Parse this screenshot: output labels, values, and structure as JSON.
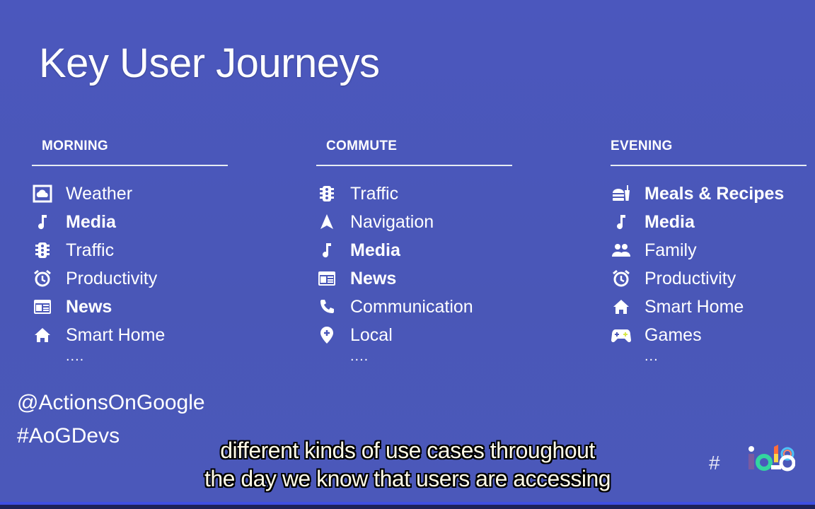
{
  "slide": {
    "title": "Key User Journeys",
    "columns": [
      {
        "header": "MORNING",
        "items": [
          {
            "icon": "weather-cloud-icon",
            "label": "Weather",
            "bold": false
          },
          {
            "icon": "music-note-icon",
            "label": "Media",
            "bold": true
          },
          {
            "icon": "traffic-light-icon",
            "label": "Traffic",
            "bold": false
          },
          {
            "icon": "alarm-clock-icon",
            "label": "Productivity",
            "bold": false
          },
          {
            "icon": "newspaper-icon",
            "label": "News",
            "bold": true
          },
          {
            "icon": "home-icon",
            "label": "Smart Home",
            "bold": false
          }
        ],
        "ellipsis": "...."
      },
      {
        "header": "COMMUTE",
        "items": [
          {
            "icon": "traffic-light-icon",
            "label": "Traffic",
            "bold": false
          },
          {
            "icon": "navigation-arrow-icon",
            "label": "Navigation",
            "bold": false
          },
          {
            "icon": "music-note-icon",
            "label": "Media",
            "bold": true
          },
          {
            "icon": "newspaper-icon",
            "label": "News",
            "bold": true
          },
          {
            "icon": "phone-icon",
            "label": "Communication",
            "bold": false
          },
          {
            "icon": "location-pin-icon",
            "label": "Local",
            "bold": false
          }
        ],
        "ellipsis": "...."
      },
      {
        "header": "EVENING",
        "items": [
          {
            "icon": "fast-food-icon",
            "label": "Meals & Recipes",
            "bold": true
          },
          {
            "icon": "music-note-icon",
            "label": "Media",
            "bold": true
          },
          {
            "icon": "people-icon",
            "label": "Family",
            "bold": false
          },
          {
            "icon": "alarm-clock-icon",
            "label": "Productivity",
            "bold": false
          },
          {
            "icon": "home-icon",
            "label": "Smart Home",
            "bold": false
          },
          {
            "icon": "gamepad-icon",
            "label": "Games",
            "bold": false
          }
        ],
        "ellipsis": "..."
      }
    ],
    "handle": "@ActionsOnGoogle",
    "hashtag": "#AoGDevs",
    "event_logo": {
      "hash": "#",
      "text": "io18"
    }
  },
  "captions": {
    "line1": "different kinds of use cases throughout",
    "line2": "the day we know that users are accessing"
  },
  "colors": {
    "background": "#4a57b9",
    "text": "#ffffff",
    "rule": "#e6ecf3",
    "caption_text": "#fffbe8"
  }
}
